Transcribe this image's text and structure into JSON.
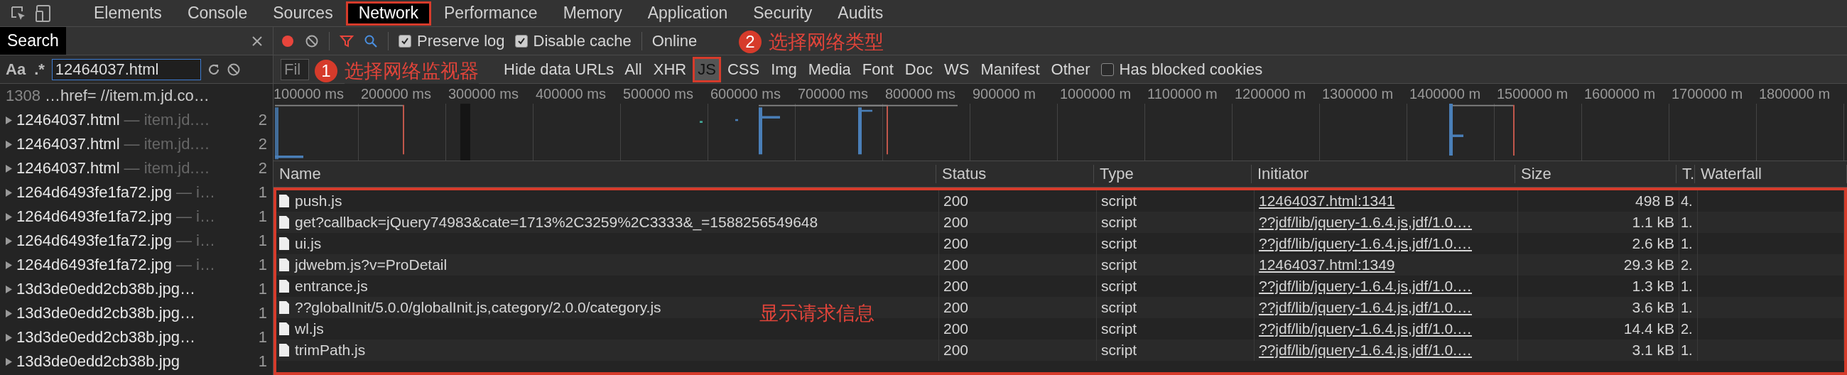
{
  "tabs": [
    {
      "label": "Elements",
      "selected": false,
      "highlighted": false
    },
    {
      "label": "Console",
      "selected": false,
      "highlighted": false
    },
    {
      "label": "Sources",
      "selected": false,
      "highlighted": false
    },
    {
      "label": "Network",
      "selected": true,
      "highlighted": true
    },
    {
      "label": "Performance",
      "selected": false,
      "highlighted": false
    },
    {
      "label": "Memory",
      "selected": false,
      "highlighted": false
    },
    {
      "label": "Application",
      "selected": false,
      "highlighted": false
    },
    {
      "label": "Security",
      "selected": false,
      "highlighted": false
    },
    {
      "label": "Audits",
      "selected": false,
      "highlighted": false
    }
  ],
  "search_panel": {
    "title": "Search",
    "case_toggle": "Aa",
    "regex_toggle": ".*",
    "query": "12464037.html",
    "results": [
      {
        "kind": "line",
        "line": "1308",
        "snippet": "…href= //item.m.jd.co…"
      },
      {
        "kind": "file",
        "name": "12464037.html",
        "source": "— item.jd.…",
        "count": "2"
      },
      {
        "kind": "file",
        "name": "12464037.html",
        "source": "— item.jd.…",
        "count": "2"
      },
      {
        "kind": "file",
        "name": "12464037.html",
        "source": "— item.jd.…",
        "count": "2"
      },
      {
        "kind": "file",
        "name": "1264d6493fe1fa72.jpg",
        "source": "— i…",
        "count": "1"
      },
      {
        "kind": "file",
        "name": "1264d6493fe1fa72.jpg",
        "source": "— i…",
        "count": "1"
      },
      {
        "kind": "file",
        "name": "1264d6493fe1fa72.jpg",
        "source": "— i…",
        "count": "1"
      },
      {
        "kind": "file",
        "name": "1264d6493fe1fa72.jpg",
        "source": "— i…",
        "count": "1"
      },
      {
        "kind": "file",
        "name": "13d3de0edd2cb38b.jpg…",
        "count": "1"
      },
      {
        "kind": "file",
        "name": "13d3de0edd2cb38b.jpg…",
        "count": "1"
      },
      {
        "kind": "file",
        "name": "13d3de0edd2cb38b.jpg…",
        "count": "1"
      },
      {
        "kind": "file",
        "name": "13d3de0edd2cb38b.jpg",
        "count": "1"
      }
    ]
  },
  "toolbar": {
    "recording": true,
    "filter_on": true,
    "options": [
      {
        "label": "Preserve log",
        "checked": true
      },
      {
        "label": "Disable cache",
        "checked": true
      }
    ],
    "throttling": "Online"
  },
  "filter_bar": {
    "placeholder": "Fil",
    "hide_data_urls": "Hide data URLs",
    "types": [
      {
        "label": "All",
        "selected": false,
        "highlighted": false
      },
      {
        "label": "XHR",
        "selected": false,
        "highlighted": false
      },
      {
        "label": "JS",
        "selected": true,
        "highlighted": true
      },
      {
        "label": "CSS",
        "selected": false,
        "highlighted": false
      },
      {
        "label": "Img",
        "selected": false,
        "highlighted": false
      },
      {
        "label": "Media",
        "selected": false,
        "highlighted": false
      },
      {
        "label": "Font",
        "selected": false,
        "highlighted": false
      },
      {
        "label": "Doc",
        "selected": false,
        "highlighted": false
      },
      {
        "label": "WS",
        "selected": false,
        "highlighted": false
      },
      {
        "label": "Manifest",
        "selected": false,
        "highlighted": false
      },
      {
        "label": "Other",
        "selected": false,
        "highlighted": false
      }
    ],
    "blocked_cookies": {
      "label": "Has blocked cookies",
      "checked": false
    }
  },
  "overview": {
    "ticks": [
      "100000 ms",
      "200000 ms",
      "300000 ms",
      "400000 ms",
      "500000 ms",
      "600000 ms",
      "700000 ms",
      "800000 ms",
      "900000 m",
      "1000000 m",
      "1100000 m",
      "1200000 m",
      "1300000 m",
      "1400000 m",
      "1500000 m",
      "1600000 m",
      "1700000 m",
      "1800000 m"
    ]
  },
  "table": {
    "highlighted": true,
    "columns": [
      "Name",
      "Status",
      "Type",
      "Initiator",
      "Size",
      "T.",
      "Waterfall"
    ],
    "rows": [
      {
        "name": "push.js",
        "status": "200",
        "type": "script",
        "initiator": "12464037.html:1341",
        "size": "498 B",
        "time": "4."
      },
      {
        "name": "get?callback=jQuery74983&cate=1713%2C3259%2C3333&_=1588256549648",
        "status": "200",
        "type": "script",
        "initiator": "??jdf/lib/jquery-1.6.4.js,jdf/1.0.…",
        "size": "1.1 kB",
        "time": "1."
      },
      {
        "name": "ui.js",
        "status": "200",
        "type": "script",
        "initiator": "??jdf/lib/jquery-1.6.4.js,jdf/1.0.…",
        "size": "2.6 kB",
        "time": "1."
      },
      {
        "name": "jdwebm.js?v=ProDetail",
        "status": "200",
        "type": "script",
        "initiator": "12464037.html:1349",
        "size": "29.3 kB",
        "time": "2."
      },
      {
        "name": "entrance.js",
        "status": "200",
        "type": "script",
        "initiator": "??jdf/lib/jquery-1.6.4.js,jdf/1.0.…",
        "size": "1.3 kB",
        "time": "1."
      },
      {
        "name": "??globalInit/5.0.0/globalInit.js,category/2.0.0/category.js",
        "status": "200",
        "type": "script",
        "initiator": "??jdf/lib/jquery-1.6.4.js,jdf/1.0.…",
        "size": "3.6 kB",
        "time": "1."
      },
      {
        "name": "wl.js",
        "status": "200",
        "type": "script",
        "initiator": "??jdf/lib/jquery-1.6.4.js,jdf/1.0.…",
        "size": "14.4 kB",
        "time": "2."
      },
      {
        "name": "trimPath.js",
        "status": "200",
        "type": "script",
        "initiator": "??jdf/lib/jquery-1.6.4.js,jdf/1.0.…",
        "size": "3.1 kB",
        "time": "1."
      }
    ]
  },
  "annotations": [
    {
      "number": "1",
      "text": "选择网络监视器"
    },
    {
      "number": "2",
      "text": "选择网络类型"
    }
  ],
  "callout": "显示请求信息"
}
